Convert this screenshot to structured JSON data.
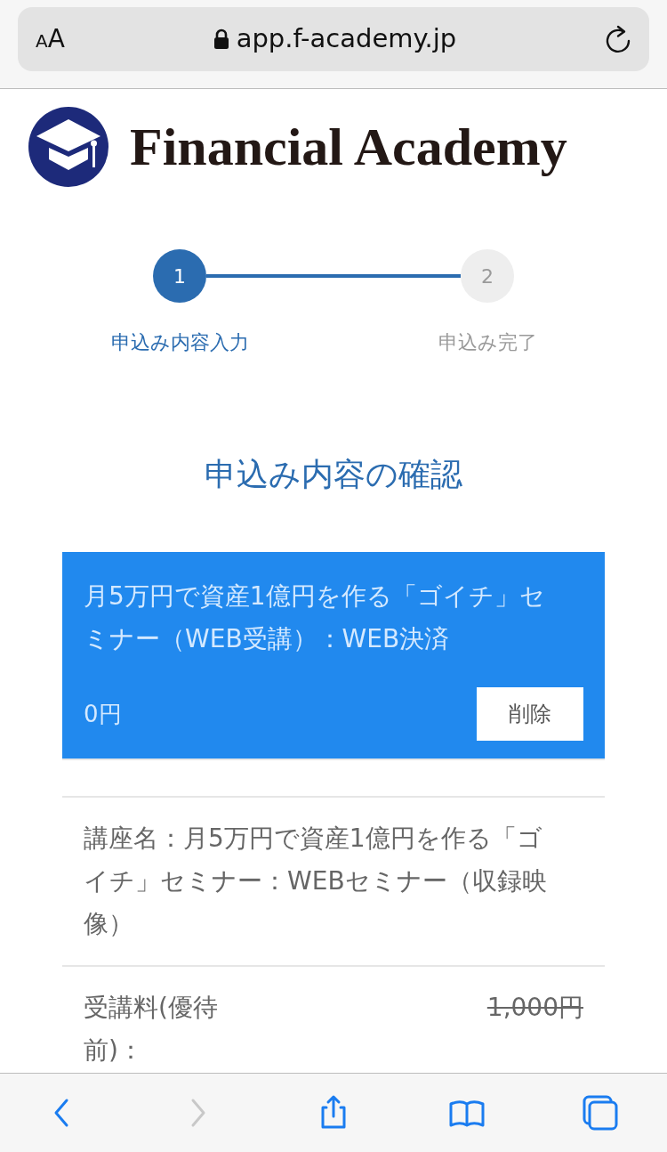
{
  "address_bar": {
    "text_size_button": {
      "small_letter": "A",
      "large_letter": "A"
    },
    "url": "app.f-academy.jp",
    "secure": true
  },
  "logo": {
    "text": "Financial Academy"
  },
  "steps": [
    {
      "number": "1",
      "label": "申込み内容入力",
      "selected": true
    },
    {
      "number": "2",
      "label": "申込み完了",
      "selected": false
    }
  ],
  "heading": "申込み内容の確認",
  "cart_item": {
    "title": "月5万円で資産1億円を作る「ゴイチ」セミナー（WEB受講）：WEB決済",
    "price": "0円",
    "remove_button": "削除"
  },
  "details": [
    {
      "kind": "text",
      "text": "講座名：月5万円で資産1億円を作る「ゴイチ」セミナー：WEBセミナー（収録映像）"
    },
    {
      "kind": "price",
      "label": "受講料(優待前)：",
      "value": "1,000円",
      "struck": true
    }
  ],
  "toolbar": [
    {
      "kind": "back",
      "disabled": false
    },
    {
      "kind": "forward",
      "disabled": true
    },
    {
      "kind": "share",
      "disabled": false
    },
    {
      "kind": "bookmarks",
      "disabled": false
    },
    {
      "kind": "tabs",
      "disabled": false
    }
  ]
}
